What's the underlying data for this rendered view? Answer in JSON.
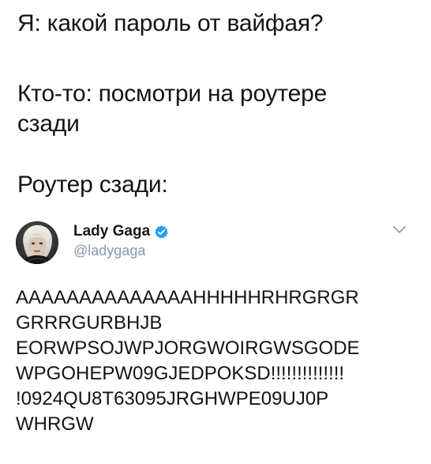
{
  "captions": {
    "line1": "Я: какой пароль от вайфая?",
    "line2": "Кто-то: посмотри на роутере сзади",
    "line3": "Роутер сзади:"
  },
  "tweet": {
    "display_name": "Lady Gaga",
    "handle": "@ladygaga",
    "verified": true,
    "avatar_icon": "avatar-photo",
    "menu_icon": "chevron-down-icon",
    "accent_color": "#1da1f2",
    "text_lines": [
      "AAAAAAAAAAAAAAHHHHHRHRGRGR",
      "GRRRGURBHJB",
      "EORWPSOJWPJORGWOIRGWSGODE",
      "WPGOHEPW09GJEDPOKSD!!!!!!!!!!!!!!",
      "!0924QU8T63095JRGHWPE09UJ0P",
      "WHRGW"
    ]
  }
}
